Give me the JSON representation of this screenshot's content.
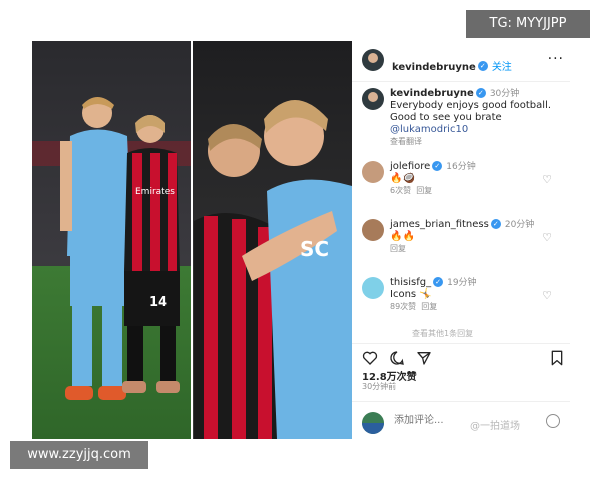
{
  "watermarks": {
    "top": "TG: MYYJJPP",
    "bottom": "www.zzyjjq.com",
    "weibo": "@一拍道场"
  },
  "photo": {
    "left": {
      "shirt_numbers": [
        "14"
      ],
      "sponsor_text": "Emirates FLY BETTER"
    },
    "right": {
      "shirt_text": "SC"
    }
  },
  "post": {
    "header": {
      "username": "kevindebruyne",
      "follow_label": "关注"
    },
    "caption": {
      "username": "kevindebruyne",
      "time": "30分钟",
      "line1": "Everybody enjoys good football.",
      "line2": "Good to see you brate",
      "mention": "@lukamodric10",
      "translate": "查看翻译"
    },
    "comments": [
      {
        "username": "jolefiore",
        "time": "16分钟",
        "text": "🔥🥥",
        "likes": "6次赞",
        "reply": "回复"
      },
      {
        "username": "james_brian_fitness",
        "time": "20分钟",
        "text": "🔥🔥",
        "likes": "",
        "reply": "回复"
      },
      {
        "username": "thisisfg_",
        "time": "19分钟",
        "text": "Icons 🤸",
        "likes": "89次赞",
        "reply": "回复"
      }
    ],
    "hidden_replies": "查看其他1条回复",
    "likes": "12.8万次赞",
    "posted": "30分钟前",
    "comment_placeholder": "添加评论..."
  },
  "icons": [
    "verified-icon",
    "more-icon",
    "heart-icon",
    "comment-icon",
    "share-icon",
    "bookmark-icon",
    "emoji-icon"
  ],
  "colors": {
    "verified": "#3897f0",
    "follow": "#0095f6",
    "napoli_blue": "#6cb4e4",
    "milan_red": "#c8102e"
  }
}
